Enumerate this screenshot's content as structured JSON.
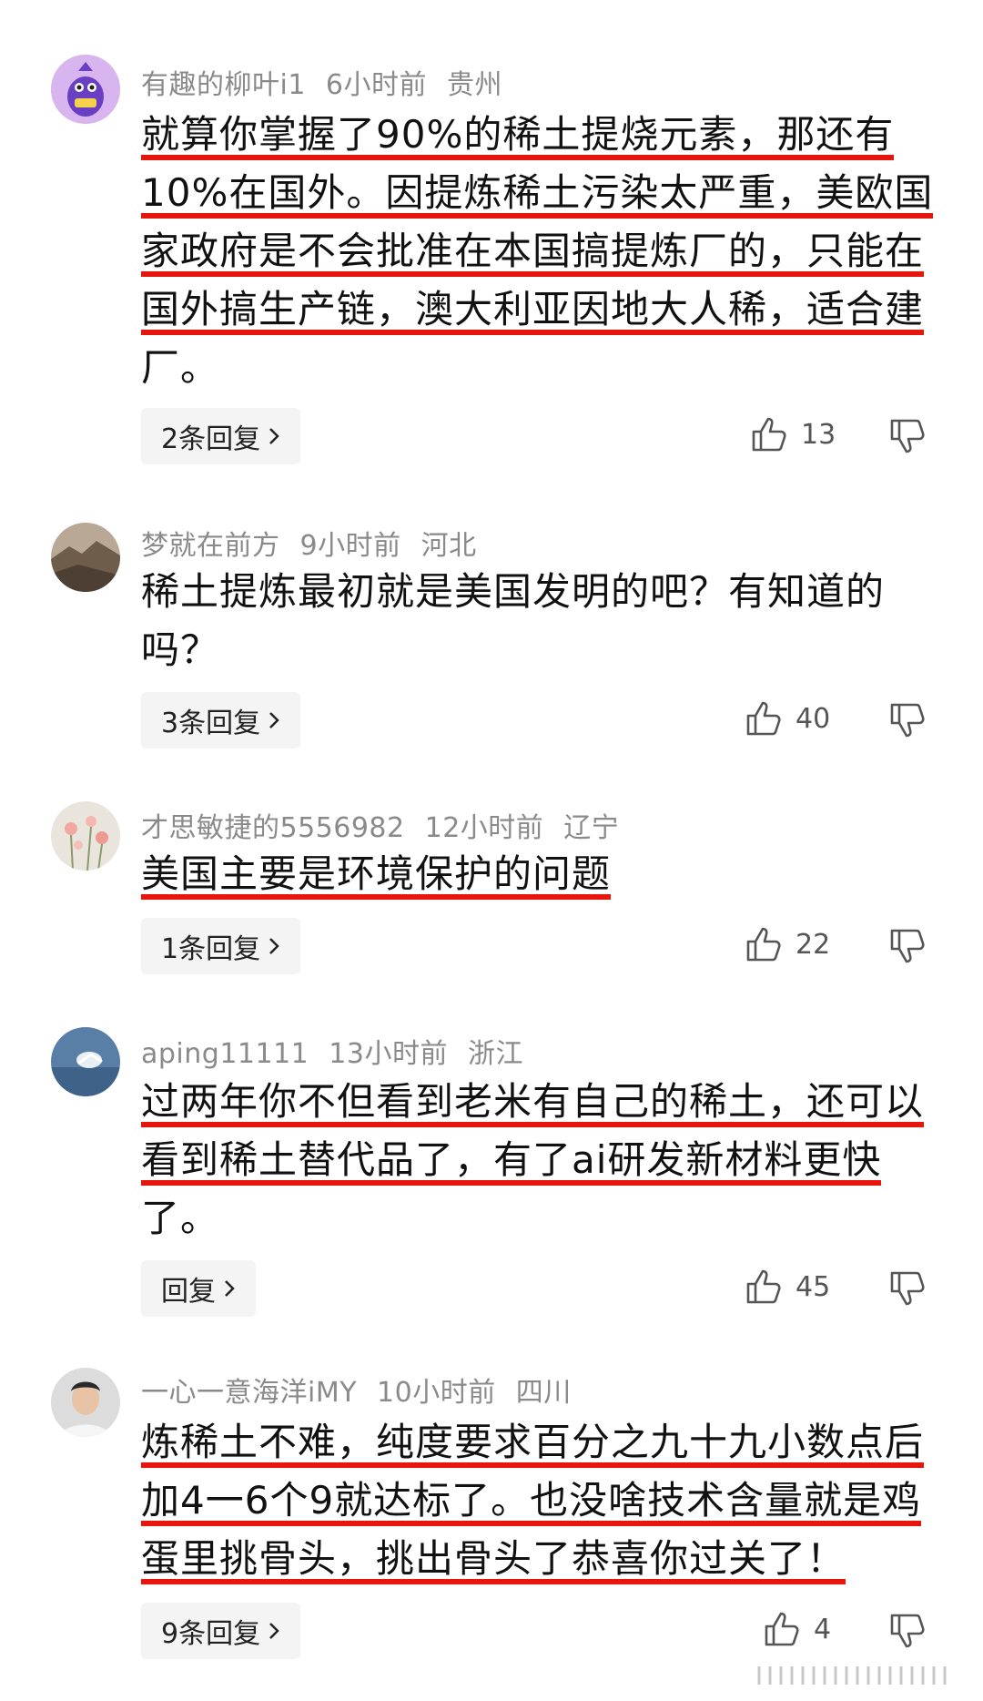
{
  "comments": [
    {
      "username": "有趣的柳叶i1",
      "time": "6小时前",
      "location": "贵州",
      "text": "就算你掌握了90%的稀土提烧元素，那还有10%在国外。因提炼稀土污染太严重，美欧国家政府是不会批准在本国搞提炼厂的，只能在国外搞生产链，澳大利亚因地大人稀，适合建",
      "text_tail": "厂。",
      "reply_label": "2条回复",
      "likes": "13",
      "avatar_icon": "purple-cartoon-avatar"
    },
    {
      "username": "梦就在前方",
      "time": "9小时前",
      "location": "河北",
      "text": "稀土提炼最初就是美国发明的吧？有知道的吗？",
      "reply_label": "3条回复",
      "likes": "40",
      "avatar_icon": "landscape-photo-avatar"
    },
    {
      "username": "才思敏捷的5556982",
      "time": "12小时前",
      "location": "辽宁",
      "text": "美国主要是环境保护的问题",
      "reply_label": "1条回复",
      "likes": "22",
      "avatar_icon": "flower-photo-avatar"
    },
    {
      "username": "aping11111",
      "time": "13小时前",
      "location": "浙江",
      "text": "过两年你不但看到老米有自己的稀土，还可以看到稀土替代品了，有了ai研发新材料更快",
      "text_tail": "了。",
      "reply_label": "回复",
      "likes": "45",
      "avatar_icon": "sky-photo-avatar"
    },
    {
      "username": "一心一意海洋iMY",
      "time": "10小时前",
      "location": "四川",
      "text": "炼稀土不难，纯度要求百分之九十九小数点后加4一6个9就达标了。也没啥技术含量就是鸡蛋里挑骨头，挑出骨头了恭喜你过关了！",
      "reply_label": "9条回复",
      "likes": "4",
      "avatar_icon": "person-photo-avatar"
    }
  ],
  "colors": {
    "highlight": "#e8150c",
    "meta": "#8a8a8a",
    "reply_bg": "#f4f4f4"
  }
}
